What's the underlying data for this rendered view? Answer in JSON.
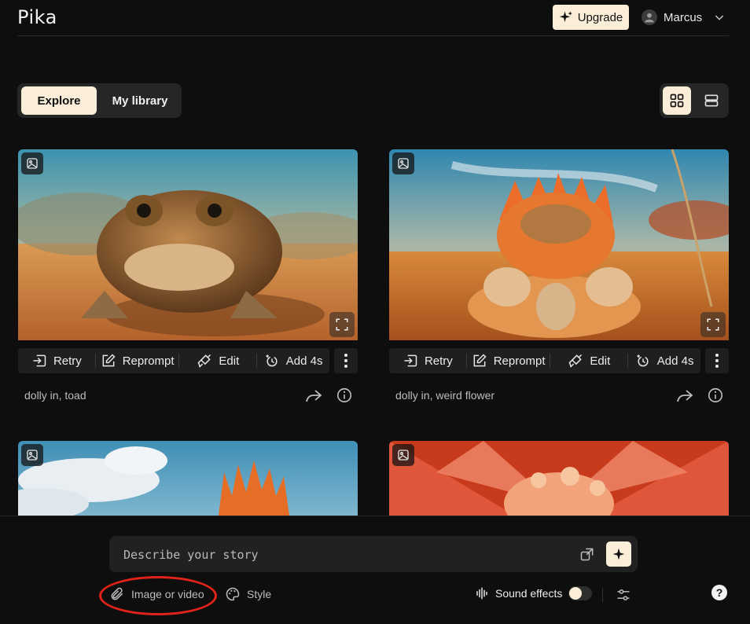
{
  "app": {
    "logo": "Pika"
  },
  "header": {
    "upgrade_label": "Upgrade",
    "user_name": "Marcus"
  },
  "tabs": {
    "explore": "Explore",
    "library": "My library"
  },
  "cards": [
    {
      "caption": "dolly in, toad"
    },
    {
      "caption": "dolly in, weird flower"
    }
  ],
  "actions": {
    "retry": "Retry",
    "reprompt": "Reprompt",
    "edit": "Edit",
    "add": "Add 4s"
  },
  "composer": {
    "placeholder": "Describe your story",
    "image_or_video": "Image or video",
    "style": "Style",
    "sound_effects": "Sound effects",
    "help": "?"
  },
  "colors": {
    "accent": "#fbeed9",
    "background": "#0e0e0e",
    "annotation_ring": "#e2231a"
  }
}
